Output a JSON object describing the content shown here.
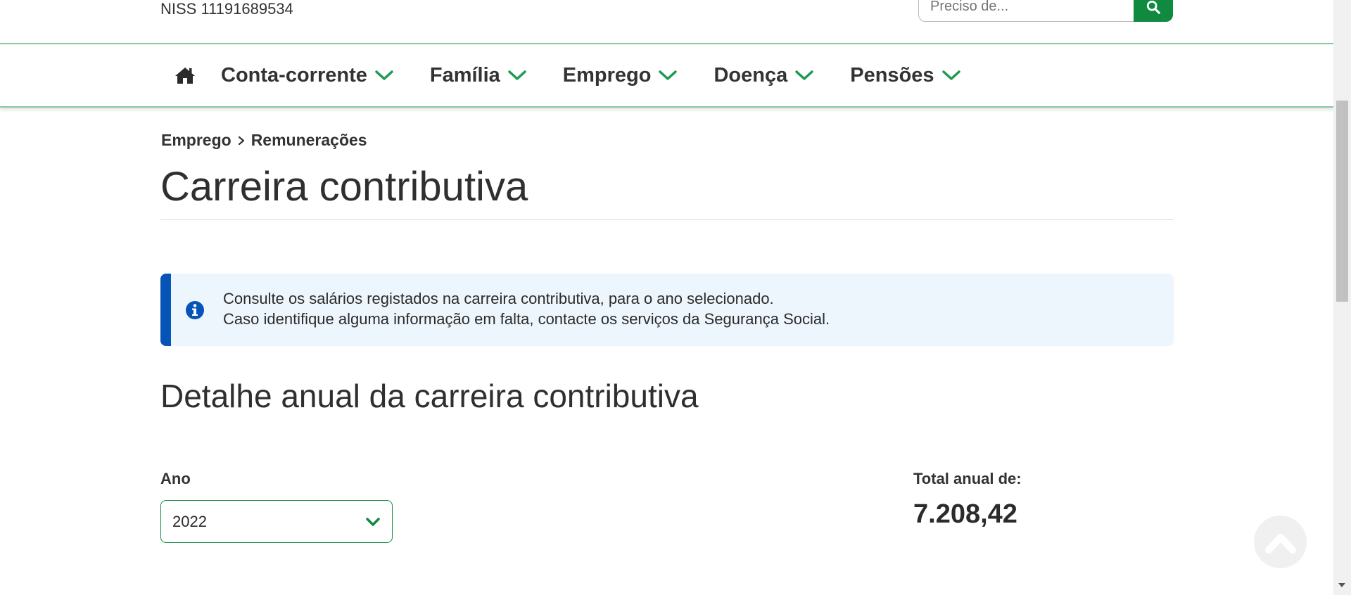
{
  "header": {
    "niss": "NISS 11191689534",
    "search_placeholder": "Preciso de..."
  },
  "nav": {
    "items": [
      {
        "label": "Conta-corrente"
      },
      {
        "label": "Família"
      },
      {
        "label": "Emprego"
      },
      {
        "label": "Doença"
      },
      {
        "label": "Pensões"
      }
    ]
  },
  "breadcrumb": {
    "items": [
      "Emprego",
      "Remunerações"
    ]
  },
  "page": {
    "title": "Carreira contributiva"
  },
  "info": {
    "line1": "Consulte os salários registados na carreira contributiva, para o ano selecionado.",
    "line2": "Caso identifique alguma informação em falta, contacte os serviços da Segurança Social."
  },
  "detail": {
    "section_title": "Detalhe anual da carreira contributiva",
    "year_label": "Ano",
    "year_value": "2022",
    "total_label": "Total anual de:",
    "total_value": "7.208,42"
  },
  "colors": {
    "brand_green": "#0f8a3e",
    "info_blue": "#0654b8",
    "info_bg": "#eef6fd"
  }
}
